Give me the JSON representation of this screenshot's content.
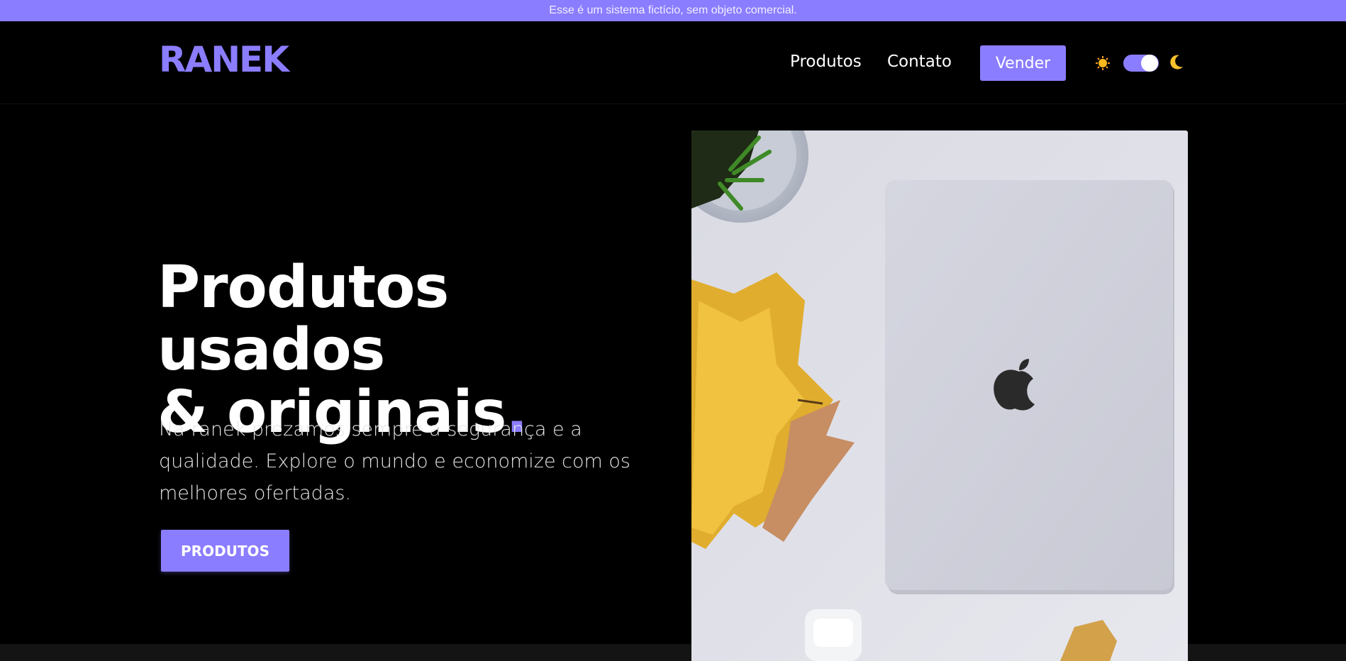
{
  "notice": {
    "text": "Esse é um sistema fictício, sem objeto comercial."
  },
  "header": {
    "logo": "RANEK",
    "nav": [
      {
        "label": "Produtos"
      },
      {
        "label": "Contato"
      }
    ],
    "sell_label": "Vender",
    "theme_toggle": {
      "state": "dark",
      "sun_icon": "sun-icon",
      "moon_icon": "moon-icon"
    }
  },
  "hero": {
    "title_line1": "Produtos usados",
    "title_line2": "& originais",
    "title_dot": ".",
    "text": "Na ranek prezamos sempre a segurança e a qualidade. Explore o mundo e economize com os melhores ofertadas.",
    "cta_label": "PRODUTOS",
    "image_alt_semantic": "laptop-on-desk-photo"
  },
  "colors": {
    "accent": "#8b7dff",
    "background": "#000000",
    "text": "#ffffff"
  }
}
